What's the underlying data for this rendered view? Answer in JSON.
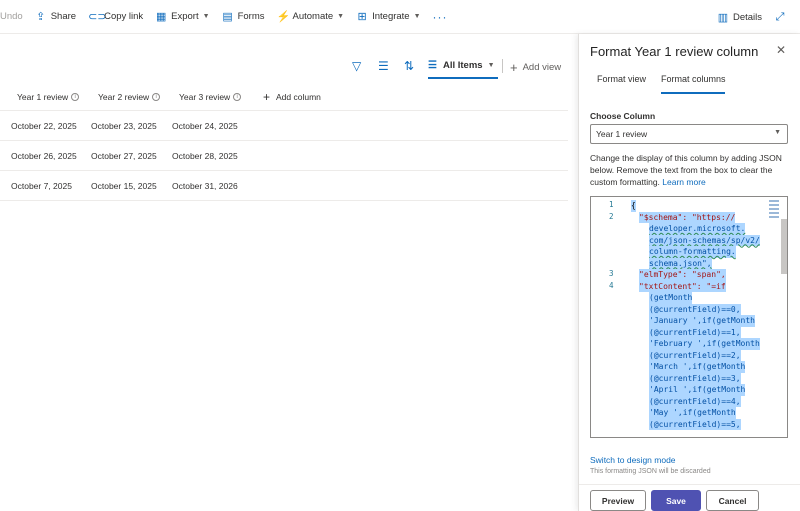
{
  "toolbar": {
    "undo": "Undo",
    "share": "Share",
    "copy_link": "Copy link",
    "export": "Export",
    "forms": "Forms",
    "automate": "Automate",
    "integrate": "Integrate",
    "more": "···",
    "details": "Details"
  },
  "view": {
    "current": "All Items",
    "add_view": "Add view"
  },
  "grid": {
    "columns": [
      "Year 1 review",
      "Year 2 review",
      "Year 3 review"
    ],
    "add_column": "Add column",
    "rows": [
      [
        "October 22, 2025",
        "October 23, 2025",
        "October 24, 2025"
      ],
      [
        "October 26, 2025",
        "October 27, 2025",
        "October 28, 2025"
      ],
      [
        "October 7, 2025",
        "October 15, 2025",
        "October 31, 2026"
      ]
    ]
  },
  "pane": {
    "title": "Format Year 1 review column",
    "tabs": [
      "Format view",
      "Format columns"
    ],
    "active_tab": "Format columns",
    "choose_label": "Choose Column",
    "choose_value": "Year 1 review",
    "description": "Change the display of this column by adding JSON below. Remove the text from the box to clear the custom formatting.",
    "learn_more": "Learn more",
    "line_numbers": [
      "1",
      "2",
      "3",
      "4"
    ],
    "code_lines": [
      "{",
      "\"$schema\": \"https://",
      "developer.microsoft.",
      "com/json-schemas/sp/v2/",
      "column-formatting.",
      "schema.json\",",
      "\"elmType\": \"span\",",
      "\"txtContent\": \"=if",
      "(getMonth",
      "(@currentField)==0,",
      "'January ',if(getMonth",
      "(@currentField)==1,",
      "'February ',if(getMonth",
      "(@currentField)==2,",
      "'March ',if(getMonth",
      "(@currentField)==3,",
      "'April ',if(getMonth",
      "(@currentField)==4,",
      "'May ',if(getMonth",
      "(@currentField)==5,"
    ],
    "switch_mode": "Switch to design mode",
    "warning": "This formatting JSON will be discarded",
    "preview": "Preview",
    "save": "Save",
    "cancel": "Cancel"
  },
  "colors": {
    "accent": "#0f6cbd",
    "save_button": "#4f52b2",
    "selection": "#add6ff"
  }
}
